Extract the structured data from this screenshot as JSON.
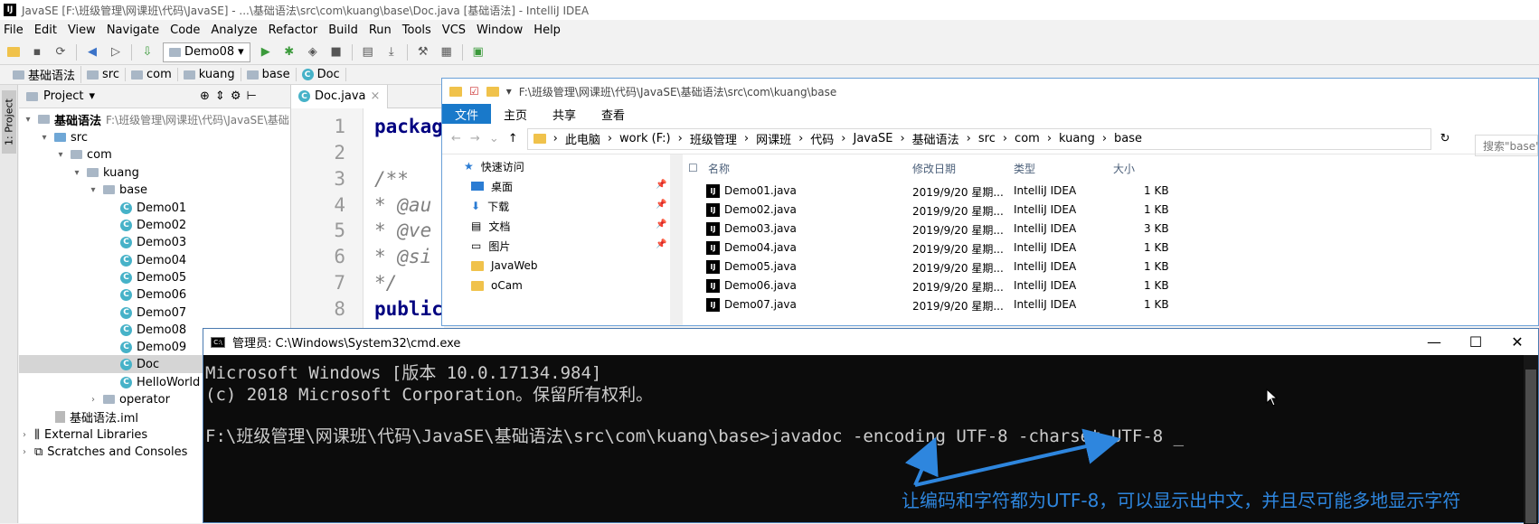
{
  "window_title": "JavaSE [F:\\班级管理\\网课班\\代码\\JavaSE] - ...\\基础语法\\src\\com\\kuang\\base\\Doc.java [基础语法] - IntelliJ IDEA",
  "menu": [
    "File",
    "Edit",
    "View",
    "Navigate",
    "Code",
    "Analyze",
    "Refactor",
    "Build",
    "Run",
    "Tools",
    "VCS",
    "Window",
    "Help"
  ],
  "toolbar": {
    "run_config": "Demo08"
  },
  "breadcrumb": [
    "基础语法",
    "src",
    "com",
    "kuang",
    "base",
    "Doc"
  ],
  "project_panel": {
    "stripe_label": "1: Project",
    "header": "Project",
    "root": "基础语法",
    "root_path": "F:\\班级管理\\网课班\\代码\\JavaSE\\基础",
    "tree": {
      "src": "src",
      "com": "com",
      "kuang": "kuang",
      "base": "base",
      "classes": [
        "Demo01",
        "Demo02",
        "Demo03",
        "Demo04",
        "Demo05",
        "Demo06",
        "Demo07",
        "Demo08",
        "Demo09",
        "Doc",
        "HelloWorld"
      ],
      "operator": "operator",
      "iml": "基础语法.iml",
      "ext_libs": "External Libraries",
      "scratches": "Scratches and Consoles"
    }
  },
  "editor": {
    "tab": "Doc.java",
    "line_numbers": [
      "1",
      "2",
      "3",
      "4",
      "5",
      "6",
      "7",
      "8"
    ],
    "lines": [
      "packag",
      "",
      "/**",
      " * @au",
      " * @ve",
      " * @si",
      " */",
      "public"
    ]
  },
  "explorer": {
    "path_title": "F:\\班级管理\\网课班\\代码\\JavaSE\\基础语法\\src\\com\\kuang\\base",
    "ribbon": [
      "文件",
      "主页",
      "共享",
      "查看"
    ],
    "address": [
      "此电脑",
      "work (F:)",
      "班级管理",
      "网课班",
      "代码",
      "JavaSE",
      "基础语法",
      "src",
      "com",
      "kuang",
      "base"
    ],
    "search_placeholder": "搜索\"base\"",
    "nav": [
      "快速访问",
      "桌面",
      "下载",
      "文档",
      "图片",
      "JavaWeb",
      "oCam"
    ],
    "columns": [
      "名称",
      "修改日期",
      "类型",
      "大小"
    ],
    "files": [
      {
        "name": "Demo01.java",
        "date": "2019/9/20 星期...",
        "type": "IntelliJ IDEA",
        "size": "1 KB"
      },
      {
        "name": "Demo02.java",
        "date": "2019/9/20 星期...",
        "type": "IntelliJ IDEA",
        "size": "1 KB"
      },
      {
        "name": "Demo03.java",
        "date": "2019/9/20 星期...",
        "type": "IntelliJ IDEA",
        "size": "3 KB"
      },
      {
        "name": "Demo04.java",
        "date": "2019/9/20 星期...",
        "type": "IntelliJ IDEA",
        "size": "1 KB"
      },
      {
        "name": "Demo05.java",
        "date": "2019/9/20 星期...",
        "type": "IntelliJ IDEA",
        "size": "1 KB"
      },
      {
        "name": "Demo06.java",
        "date": "2019/9/20 星期...",
        "type": "IntelliJ IDEA",
        "size": "1 KB"
      },
      {
        "name": "Demo07.java",
        "date": "2019/9/20 星期...",
        "type": "IntelliJ IDEA",
        "size": "1 KB"
      }
    ]
  },
  "cmd": {
    "title": "管理员: C:\\Windows\\System32\\cmd.exe",
    "lines": [
      "Microsoft Windows [版本 10.0.17134.984]",
      "(c) 2018 Microsoft Corporation。保留所有权利。",
      "",
      "F:\\班级管理\\网课班\\代码\\JavaSE\\基础语法\\src\\com\\kuang\\base>javadoc -encoding UTF-8 -charset UTF-8 _"
    ]
  },
  "annotation": "让编码和字符都为UTF-8，可以显示出中文，并且尽可能多地显示字符",
  "colors": {
    "annotation": "#2e86de",
    "explorer_accent": "#1979ca",
    "cmd_bg": "#0c0c0c"
  }
}
